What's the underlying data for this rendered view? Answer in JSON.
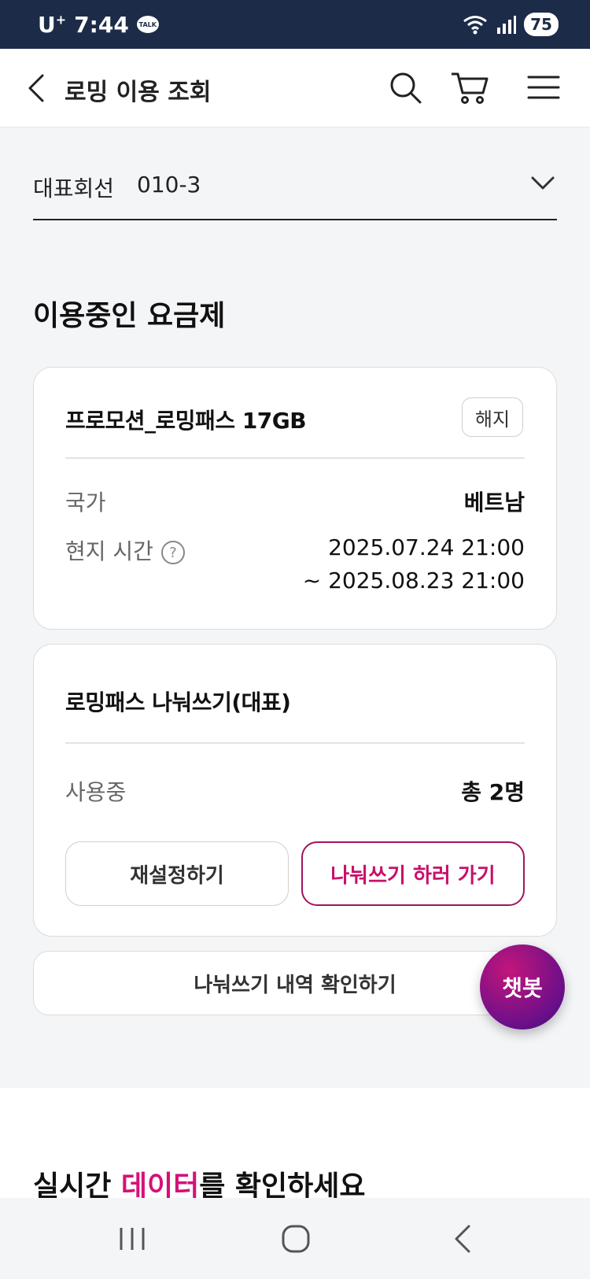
{
  "status_bar": {
    "carrier": "U",
    "carrier_sup": "+",
    "time": "7:44",
    "talk_badge": "TALK",
    "battery": "75"
  },
  "header": {
    "title": "로밍 이용 조회",
    "icons": [
      "back-icon",
      "search-icon",
      "cart-icon",
      "menu-icon"
    ]
  },
  "line_select": {
    "label": "대표회선",
    "value": "010-3"
  },
  "plan_section": {
    "title": "이용중인 요금제"
  },
  "plan_card": {
    "title": "프로모션_로밍패스 17GB",
    "cancel_label": "해지",
    "country_label": "국가",
    "country_value": "베트남",
    "time_label": "현지 시간",
    "time_start": "2025.07.24 21:00",
    "time_end": "~ 2025.08.23 21:00"
  },
  "share_card": {
    "title": "로밍패스 나눠쓰기(대표)",
    "usage_label": "사용중",
    "usage_value": "총 2명",
    "reset_button": "재설정하기",
    "share_button": "나눠쓰기 하러 가기"
  },
  "history_button": "나눠쓰기 내역 확인하기",
  "chatbot_label": "챗봇",
  "data_section": {
    "title_pre": "실시간 ",
    "title_accent": "데이터",
    "title_post": "를 확인하세요"
  },
  "colors": {
    "status_bar_bg": "#1c2b48",
    "accent": "#d4117a",
    "share_border": "#a3145c"
  }
}
